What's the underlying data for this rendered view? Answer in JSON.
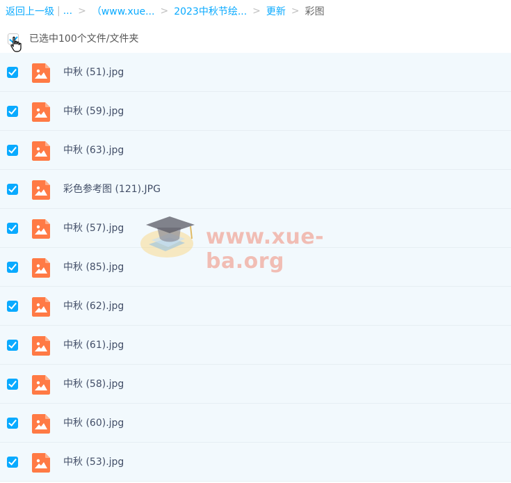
{
  "breadcrumb": {
    "back_label": "返回上一级",
    "pipe": "|",
    "ellipsis": "...",
    "items": [
      {
        "label": "（www.xue..."
      },
      {
        "label": "2023中秋节绘..."
      },
      {
        "label": "更新"
      }
    ],
    "current": "彩图",
    "separator": ">"
  },
  "selection": {
    "label": "已选中100个文件/文件夹",
    "checked": true
  },
  "files": [
    {
      "name": "中秋 (51).jpg",
      "checked": true
    },
    {
      "name": "中秋 (59).jpg",
      "checked": true
    },
    {
      "name": "中秋 (63).jpg",
      "checked": true
    },
    {
      "name": "彩色参考图 (121).JPG",
      "checked": true
    },
    {
      "name": "中秋 (57).jpg",
      "checked": true
    },
    {
      "name": "中秋 (85).jpg",
      "checked": true
    },
    {
      "name": "中秋 (62).jpg",
      "checked": true
    },
    {
      "name": "中秋 (61).jpg",
      "checked": true
    },
    {
      "name": "中秋 (58).jpg",
      "checked": true
    },
    {
      "name": "中秋 (60).jpg",
      "checked": true
    },
    {
      "name": "中秋 (53).jpg",
      "checked": true
    }
  ],
  "icons": {
    "file": "image-file-icon",
    "cursor": "hand-cursor-icon"
  },
  "watermark": {
    "text": "www.xue-ba.org"
  },
  "colors": {
    "accent": "#09AAFF",
    "file_icon": "#FF7A45",
    "list_bg": "#F2F9FD"
  }
}
